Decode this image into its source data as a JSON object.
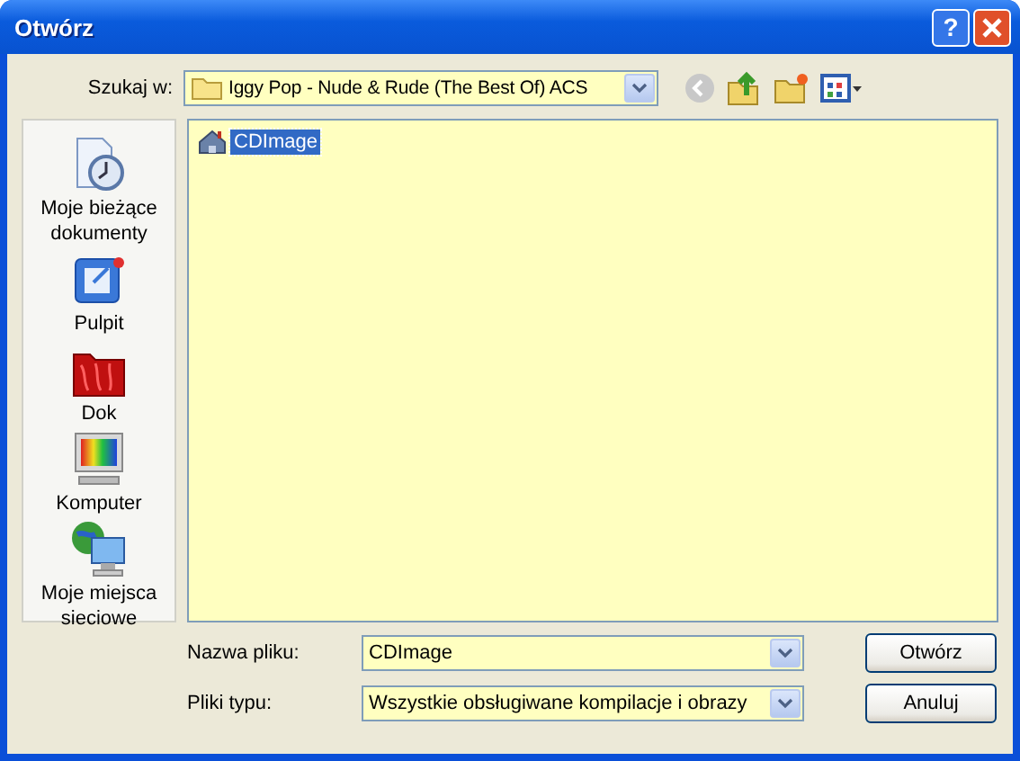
{
  "window": {
    "title": "Otwórz",
    "help_label": "?"
  },
  "look_in": {
    "label": "Szukaj w:",
    "value": "Iggy Pop - Nude & Rude (The Best Of) ACS"
  },
  "places": [
    {
      "kind": "recent",
      "label": "Moje bieżące dokumenty"
    },
    {
      "kind": "desktop",
      "label": "Pulpit"
    },
    {
      "kind": "folder",
      "label": "Dok"
    },
    {
      "kind": "computer",
      "label": "Komputer"
    },
    {
      "kind": "network",
      "label": "Moje miejsca sieciowe"
    }
  ],
  "files": [
    {
      "name": "CDImage",
      "selected": true
    }
  ],
  "file_name": {
    "label": "Nazwa pliku:",
    "value": "CDImage"
  },
  "file_type": {
    "label": "Pliki typu:",
    "value": "Wszystkie obsługiwane kompilacje i obrazy"
  },
  "buttons": [
    "Otwórz",
    "Anuluj"
  ]
}
